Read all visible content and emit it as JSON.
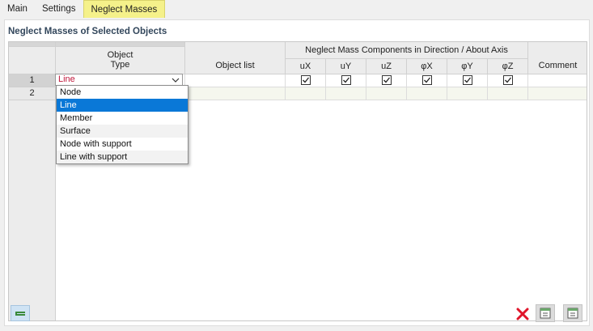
{
  "tabs": [
    {
      "label": "Main",
      "active": false
    },
    {
      "label": "Settings",
      "active": false
    },
    {
      "label": "Neglect Masses",
      "active": true
    }
  ],
  "panel": {
    "title": "Neglect Masses of Selected Objects"
  },
  "table": {
    "headers": {
      "object_type": "Object\nType",
      "object_list": "Object list",
      "group": "Neglect Mass Components in Direction / About Axis",
      "ux": "uX",
      "uy": "uY",
      "uz": "uZ",
      "phix": "φX",
      "phiy": "φY",
      "phiz": "φZ",
      "comment": "Comment"
    },
    "rows": [
      {
        "num": "1",
        "object_type": "Line",
        "object_list": "",
        "ux": true,
        "uy": true,
        "uz": true,
        "phix": true,
        "phiy": true,
        "phiz": true,
        "comment": ""
      },
      {
        "num": "2",
        "object_type": "",
        "object_list": "",
        "comment": ""
      }
    ]
  },
  "dropdown": {
    "options": [
      "Node",
      "Line",
      "Member",
      "Surface",
      "Node with support",
      "Line with support"
    ],
    "selected": "Line"
  },
  "colors": {
    "active_tab": "#f5f18a",
    "selected_option": "#0a78d7",
    "combo_value": "#c0163a",
    "delete_icon": "#e0162b"
  },
  "icons": {
    "bottom_left": "table-settings-icon",
    "delete": "delete-x-icon",
    "import": "import-table-icon",
    "export": "export-table-icon"
  }
}
